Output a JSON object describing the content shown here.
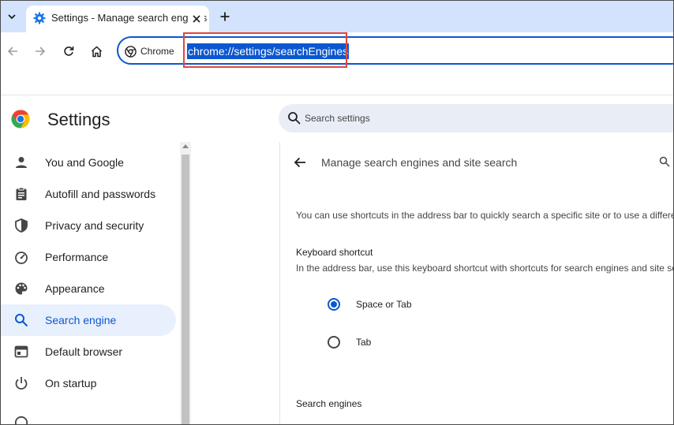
{
  "tab": {
    "title": "Settings - Manage search engines",
    "new_tab": "+"
  },
  "omnibox": {
    "chip_label": "Chrome",
    "url": "chrome://settings/searchEngines"
  },
  "header": {
    "title": "Settings",
    "search_placeholder": "Search settings"
  },
  "sidebar": {
    "items": [
      {
        "label": "You and Google",
        "icon": "person-icon"
      },
      {
        "label": "Autofill and passwords",
        "icon": "clipboard-icon"
      },
      {
        "label": "Privacy and security",
        "icon": "shield-icon"
      },
      {
        "label": "Performance",
        "icon": "speedometer-icon"
      },
      {
        "label": "Appearance",
        "icon": "palette-icon"
      },
      {
        "label": "Search engine",
        "icon": "search-icon"
      },
      {
        "label": "Default browser",
        "icon": "browser-window-icon"
      },
      {
        "label": "On startup",
        "icon": "power-icon"
      }
    ]
  },
  "main": {
    "heading": "Manage search engines and site search",
    "description": "You can use shortcuts in the address bar to quickly search a specific site or to use a different search engine",
    "keyboard_shortcut": {
      "title": "Keyboard shortcut",
      "subtitle": "In the address bar, use this keyboard shortcut with shortcuts for search engines and site search",
      "options": [
        "Space or Tab",
        "Tab"
      ],
      "selected": "Space or Tab"
    },
    "search_engines_title": "Search engines"
  },
  "colors": {
    "accent": "#0b57d0",
    "tabstrip": "#d3e3fd",
    "active_nav": "#e8f0fe",
    "highlight_box": "#e0473c"
  }
}
